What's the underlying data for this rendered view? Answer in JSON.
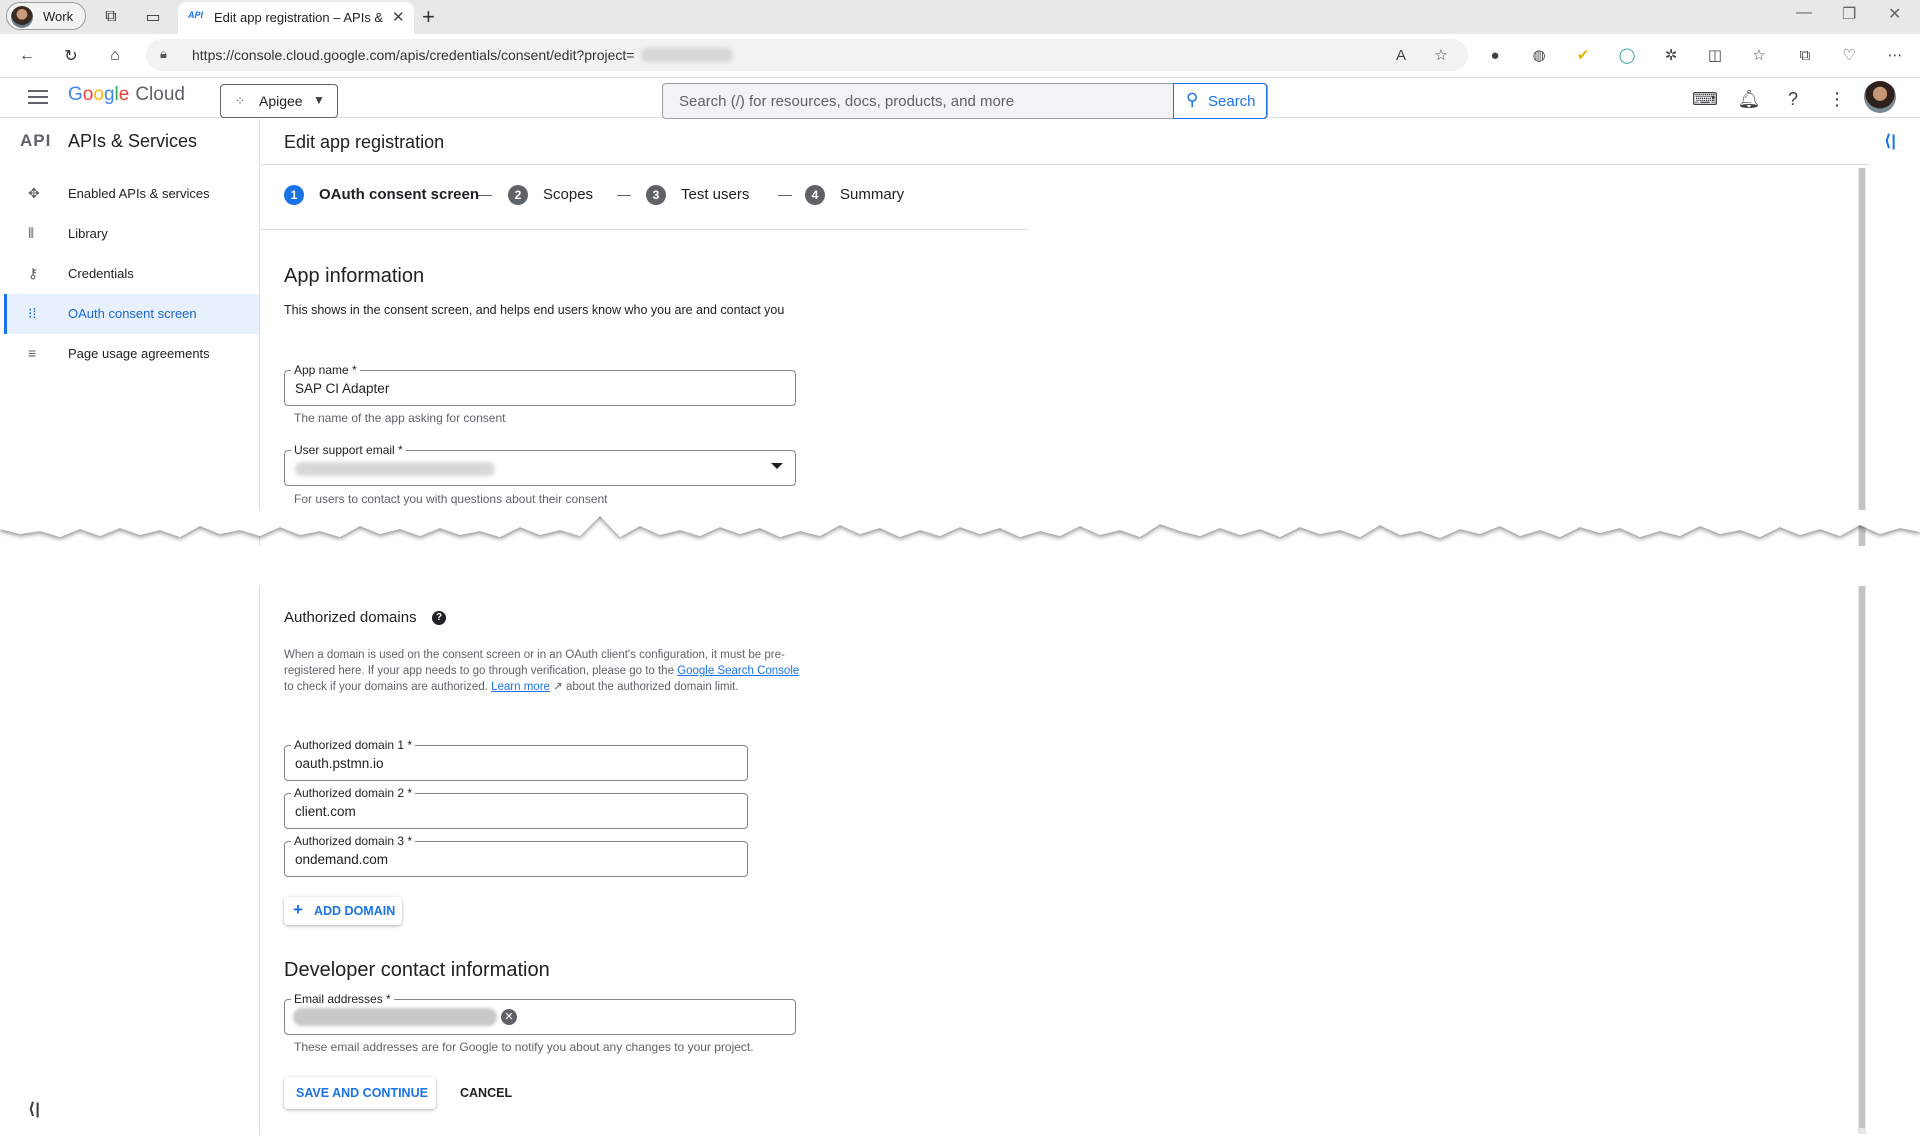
{
  "browser": {
    "profile_label": "Work",
    "tab_favicon": "API",
    "tab_title": "Edit app registration – APIs & Se",
    "url": "https://console.cloud.google.com/apis/credentials/consent/edit?project="
  },
  "header": {
    "logo_google": [
      "G",
      "o",
      "o",
      "g",
      "l",
      "e"
    ],
    "logo_cloud": "Cloud",
    "project": "Apigee",
    "search_placeholder": "Search (/) for resources, docs, products, and more",
    "search_button": "Search"
  },
  "sidebar": {
    "icon_text": "API",
    "title": "APIs & Services",
    "items": [
      {
        "label": "Enabled APIs & services",
        "icon": "enabled-apis-icon"
      },
      {
        "label": "Library",
        "icon": "library-icon"
      },
      {
        "label": "Credentials",
        "icon": "key-icon"
      },
      {
        "label": "OAuth consent screen",
        "icon": "consent-icon",
        "active": true
      },
      {
        "label": "Page usage agreements",
        "icon": "settings-list-icon"
      }
    ]
  },
  "page": {
    "title": "Edit app registration",
    "steps": [
      {
        "num": "1",
        "label": "OAuth consent screen",
        "current": true
      },
      {
        "num": "2",
        "label": "Scopes"
      },
      {
        "num": "3",
        "label": "Test users"
      },
      {
        "num": "4",
        "label": "Summary"
      }
    ]
  },
  "app_info": {
    "heading": "App information",
    "description": "This shows in the consent screen, and helps end users know who you are and contact you",
    "app_name_label": "App name *",
    "app_name_value": "SAP CI Adapter",
    "app_name_hint": "The name of the app asking for consent",
    "support_email_label": "User support email *",
    "support_email_hint": "For users to contact you with questions about their consent"
  },
  "domains": {
    "heading": "Authorized domains",
    "desc_part1": "When a domain is used on the consent screen or in an OAuth client's configuration, it must be pre-registered here. If your app needs to go through verification, please go to the ",
    "link_search_console": "Google Search Console",
    "desc_part2": " to check if your domains are authorized. ",
    "link_learn_more": "Learn more",
    "desc_part3": " about the authorized domain limit.",
    "items": [
      {
        "label": "Authorized domain 1 *",
        "value": "oauth.pstmn.io"
      },
      {
        "label": "Authorized domain 2 *",
        "value": "client.com"
      },
      {
        "label": "Authorized domain 3 *",
        "value": "ondemand.com"
      }
    ],
    "add_button": "ADD DOMAIN"
  },
  "developer": {
    "heading": "Developer contact information",
    "email_label": "Email addresses *",
    "email_hint": "These email addresses are for Google to notify you about any changes to your project."
  },
  "actions": {
    "save": "SAVE AND CONTINUE",
    "cancel": "CANCEL"
  }
}
